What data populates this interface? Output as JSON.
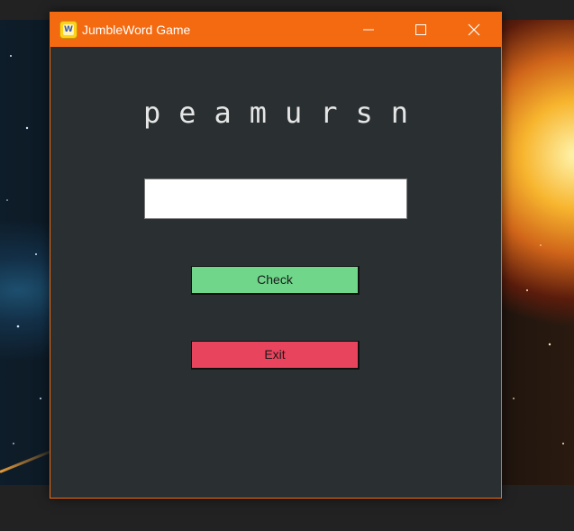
{
  "window": {
    "title": "JumbleWord Game",
    "app_icon_letter": "W",
    "accent_color": "#f46a10",
    "background_color": "#2a3032"
  },
  "titlebar_controls": {
    "minimize_icon": "minimize-icon",
    "maximize_icon": "maximize-icon",
    "close_icon": "close-icon"
  },
  "game": {
    "jumbled_word": "peamursn",
    "answer_value": "",
    "check_label": "Check",
    "exit_label": "Exit",
    "check_color": "#6fd68a",
    "exit_color": "#e8445e"
  }
}
